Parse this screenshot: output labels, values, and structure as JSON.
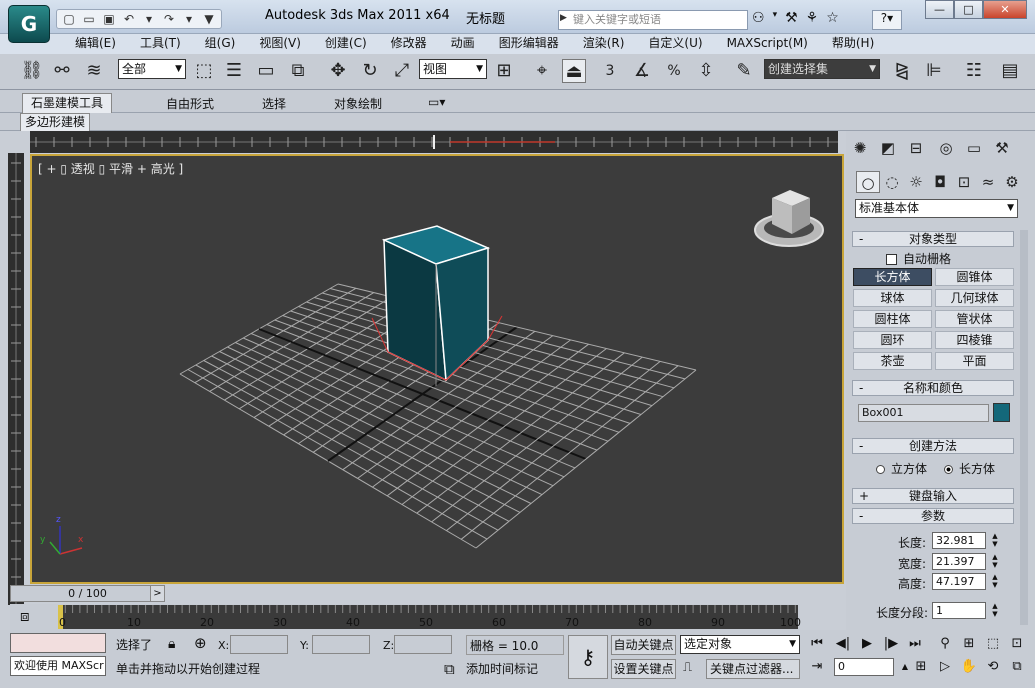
{
  "title_bar": {
    "app_logo": "G",
    "app_title": "Autodesk 3ds Max  2011 x64",
    "doc_title": "无标题",
    "search_placeholder": "键入关键字或短语",
    "window_buttons": [
      "—",
      "□",
      "✕"
    ]
  },
  "menu": [
    "编辑(E)",
    "工具(T)",
    "组(G)",
    "视图(V)",
    "创建(C)",
    "修改器",
    "动画",
    "图形编辑器",
    "渲染(R)",
    "自定义(U)",
    "MAXScript(M)",
    "帮助(H)"
  ],
  "toolbar": {
    "selection_filter": "全部",
    "ref_coord": "视图",
    "named_selection": "创建选择集",
    "snap_3": "3",
    "snap_deg": "%"
  },
  "ribbon": {
    "tabs": [
      "石墨建模工具",
      "自由形式",
      "选择",
      "对象绘制"
    ],
    "subtab": "多边形建模"
  },
  "viewport": {
    "label": "[ + ▯ 透视 ▯ 平滑 + 高光 ]"
  },
  "command_panel": {
    "category": "标准基本体",
    "object_type": {
      "header": "对象类型",
      "autogrid": "自动栅格",
      "buttons": [
        "长方体",
        "圆锥体",
        "球体",
        "几何球体",
        "圆柱体",
        "管状体",
        "圆环",
        "四棱锥",
        "茶壶",
        "平面"
      ]
    },
    "name_color": {
      "header": "名称和颜色",
      "name": "Box001",
      "color": "#14687a"
    },
    "creation_method": {
      "header": "创建方法",
      "option1": "立方体",
      "option2": "长方体"
    },
    "keyboard_input": "键盘输入",
    "params": {
      "header": "参数",
      "length_label": "长度:",
      "length": "32.981",
      "width_label": "宽度:",
      "width": "21.397",
      "height_label": "高度:",
      "height": "47.197",
      "lseg_label": "长度分段:",
      "lseg": "1"
    }
  },
  "timeline": {
    "frame": "0 / 100",
    "next": ">",
    "ticks": [
      "0",
      "10",
      "20",
      "30",
      "40",
      "50",
      "60",
      "70",
      "80",
      "90",
      "100"
    ]
  },
  "status": {
    "maxscript": "欢迎使用 MAXScr",
    "selected": "选择了",
    "prompt": "单击并拖动以开始创建过程",
    "x": "X:",
    "y": "Y:",
    "z": "Z:",
    "grid": "栅格 = 10.0",
    "add_tag": "添加时间标记",
    "auto_key": "自动关键点",
    "set_key": "设置关键点",
    "key_target": "选定对象",
    "key_filter": "关键点过滤器...",
    "current_frame": "0"
  }
}
